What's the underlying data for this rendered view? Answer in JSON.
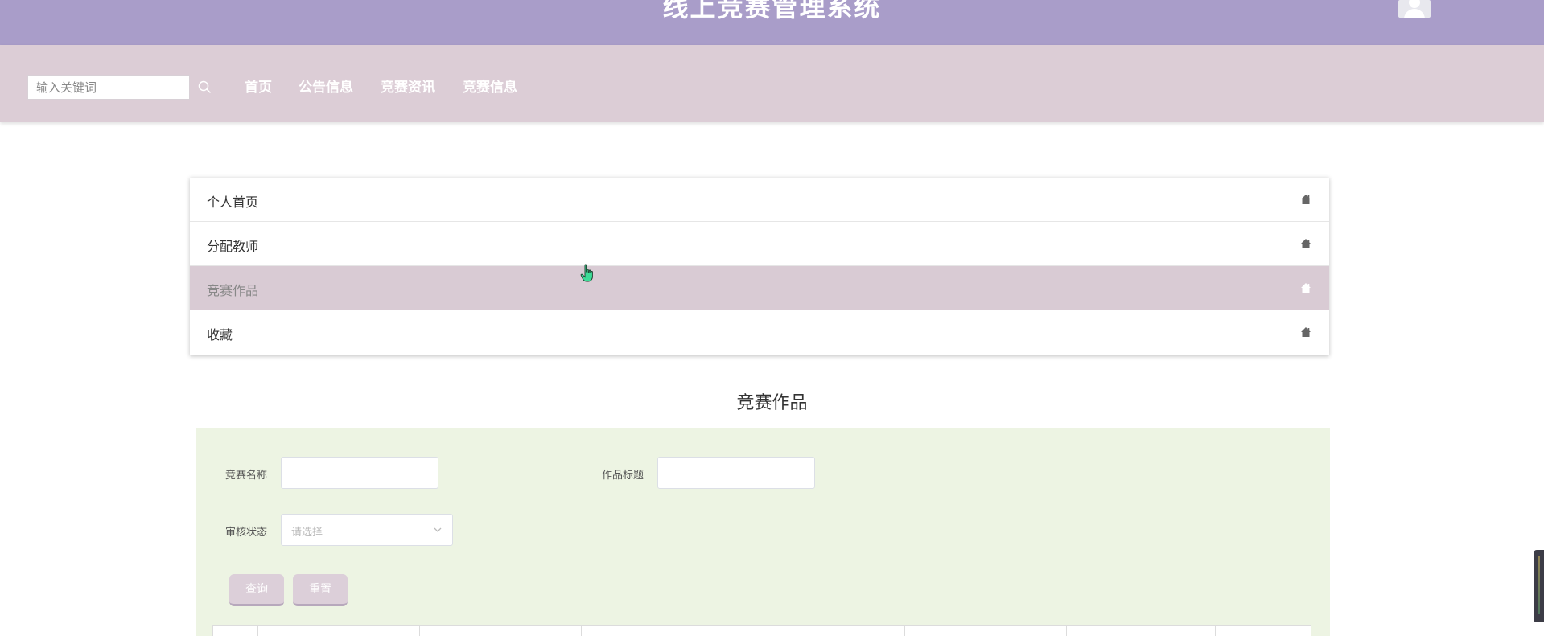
{
  "header": {
    "title": "线上竞赛管理系统",
    "bg_color": "#a99dc9"
  },
  "nav": {
    "search_placeholder": "输入关键词",
    "items": [
      "首页",
      "公告信息",
      "竞赛资讯",
      "竞赛信息"
    ],
    "bg_color": "#dccdd6"
  },
  "menu": {
    "items": [
      {
        "label": "个人首页",
        "icon": "home-icon",
        "active": false
      },
      {
        "label": "分配教师",
        "icon": "home-icon",
        "active": false
      },
      {
        "label": "竞赛作品",
        "icon": "home-icon",
        "active": true
      },
      {
        "label": "收藏",
        "icon": "home-icon",
        "active": false
      }
    ],
    "active_color": "#d9cbd4"
  },
  "section": {
    "title": "竞赛作品"
  },
  "filters": {
    "competition_name_label": "竞赛名称",
    "competition_name_value": "",
    "work_title_label": "作品标题",
    "work_title_value": "",
    "review_status_label": "审核状态",
    "review_status_placeholder": "请选择",
    "panel_color": "#edf4e3"
  },
  "buttons": {
    "query": "查询",
    "reset": "重置"
  }
}
